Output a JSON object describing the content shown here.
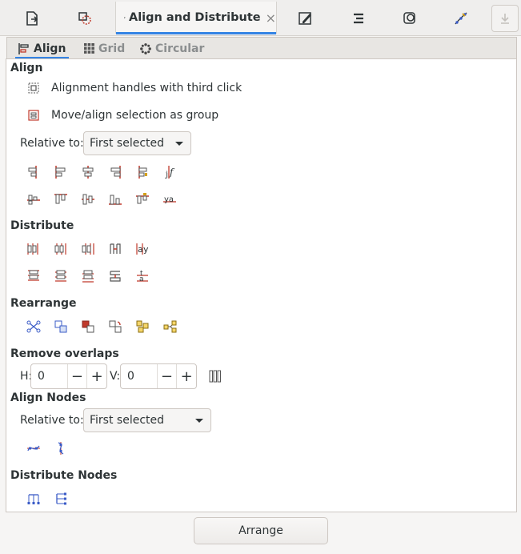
{
  "dock": {
    "active_tab_title": "Align and Distribute",
    "close_glyph": "×"
  },
  "subtabs": [
    {
      "label": "Align"
    },
    {
      "label": "Grid"
    },
    {
      "label": "Circular"
    }
  ],
  "align": {
    "title": "Align",
    "option1": "Alignment handles with third click",
    "option2": "Move/align selection as group",
    "relative_label": "Relative to:",
    "relative_value": "First selected"
  },
  "distribute": {
    "title": "Distribute"
  },
  "rearrange": {
    "title": "Rearrange"
  },
  "overlaps": {
    "title": "Remove overlaps",
    "h_label": "H:",
    "h_value": "0",
    "v_label": "V:",
    "v_value": "0",
    "minus": "−",
    "plus": "+"
  },
  "align_nodes": {
    "title": "Align Nodes",
    "relative_label": "Relative to:",
    "relative_value": "First selected"
  },
  "distribute_nodes": {
    "title": "Distribute Nodes"
  },
  "footer": {
    "arrange_label": "Arrange"
  },
  "colors": {
    "accent": "#3584e4",
    "icon_red": "#c0392b",
    "icon_blue": "#3a5bc7",
    "icon_gold": "#d4a017"
  }
}
